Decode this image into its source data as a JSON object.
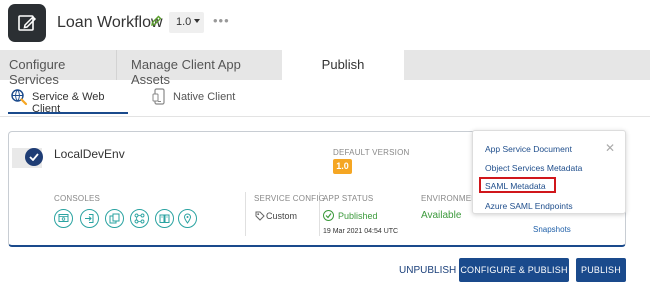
{
  "header": {
    "app_title": "Loan Workflow",
    "version": "1.0",
    "logo_icon": "edit-square-icon",
    "edit_icon": "pencil-icon",
    "more_icon": "ellipsis-icon",
    "more_label": "•••"
  },
  "tabs": [
    {
      "label": "Configure Services",
      "active": false
    },
    {
      "label": "Manage Client App Assets",
      "active": false
    },
    {
      "label": "Publish",
      "active": true
    }
  ],
  "subtabs": [
    {
      "label": "Service & Web Client",
      "active": true,
      "icon": "web-search-icon"
    },
    {
      "label": "Native Client",
      "active": false,
      "icon": "mobile-device-icon"
    }
  ],
  "environment": {
    "name": "LocalDevEnv",
    "selected": true,
    "default_version_label": "DEFAULT VERSION",
    "default_version": "1.0",
    "consoles_label": "CONSOLES",
    "console_icons": [
      "web-console-icon",
      "login-console-icon",
      "app-copy-icon",
      "integration-icon",
      "books-icon",
      "location-pin-icon"
    ],
    "service_config_label": "SERVICE CONFIG",
    "service_config_value": "Custom",
    "app_status_label": "APP STATUS",
    "app_status_value": "Published",
    "app_status_date": "19 Mar 2021 04:54 UTC",
    "environment_label": "ENVIRONMENT",
    "environment_status": "Available",
    "snapshots_label": "Snapshots"
  },
  "popup_menu": {
    "close_label": "✕",
    "items": [
      {
        "label": "App Service Document",
        "highlighted": false
      },
      {
        "label": "Object Services Metadata",
        "highlighted": false
      },
      {
        "label": "SAML Metadata",
        "highlighted": true
      },
      {
        "label": "Azure SAML Endpoints",
        "highlighted": false
      }
    ]
  },
  "footer": {
    "unpublish_label": "UNPUBLISH",
    "configure_publish_label": "CONFIGURE & PUBLISH",
    "publish_label": "PUBLISH"
  },
  "colors": {
    "primary": "#1a4a8c",
    "status_green": "#3c9a3c",
    "version_badge": "#f5a623",
    "highlight_red": "#d0161b",
    "console_teal": "#2aa3a1"
  }
}
